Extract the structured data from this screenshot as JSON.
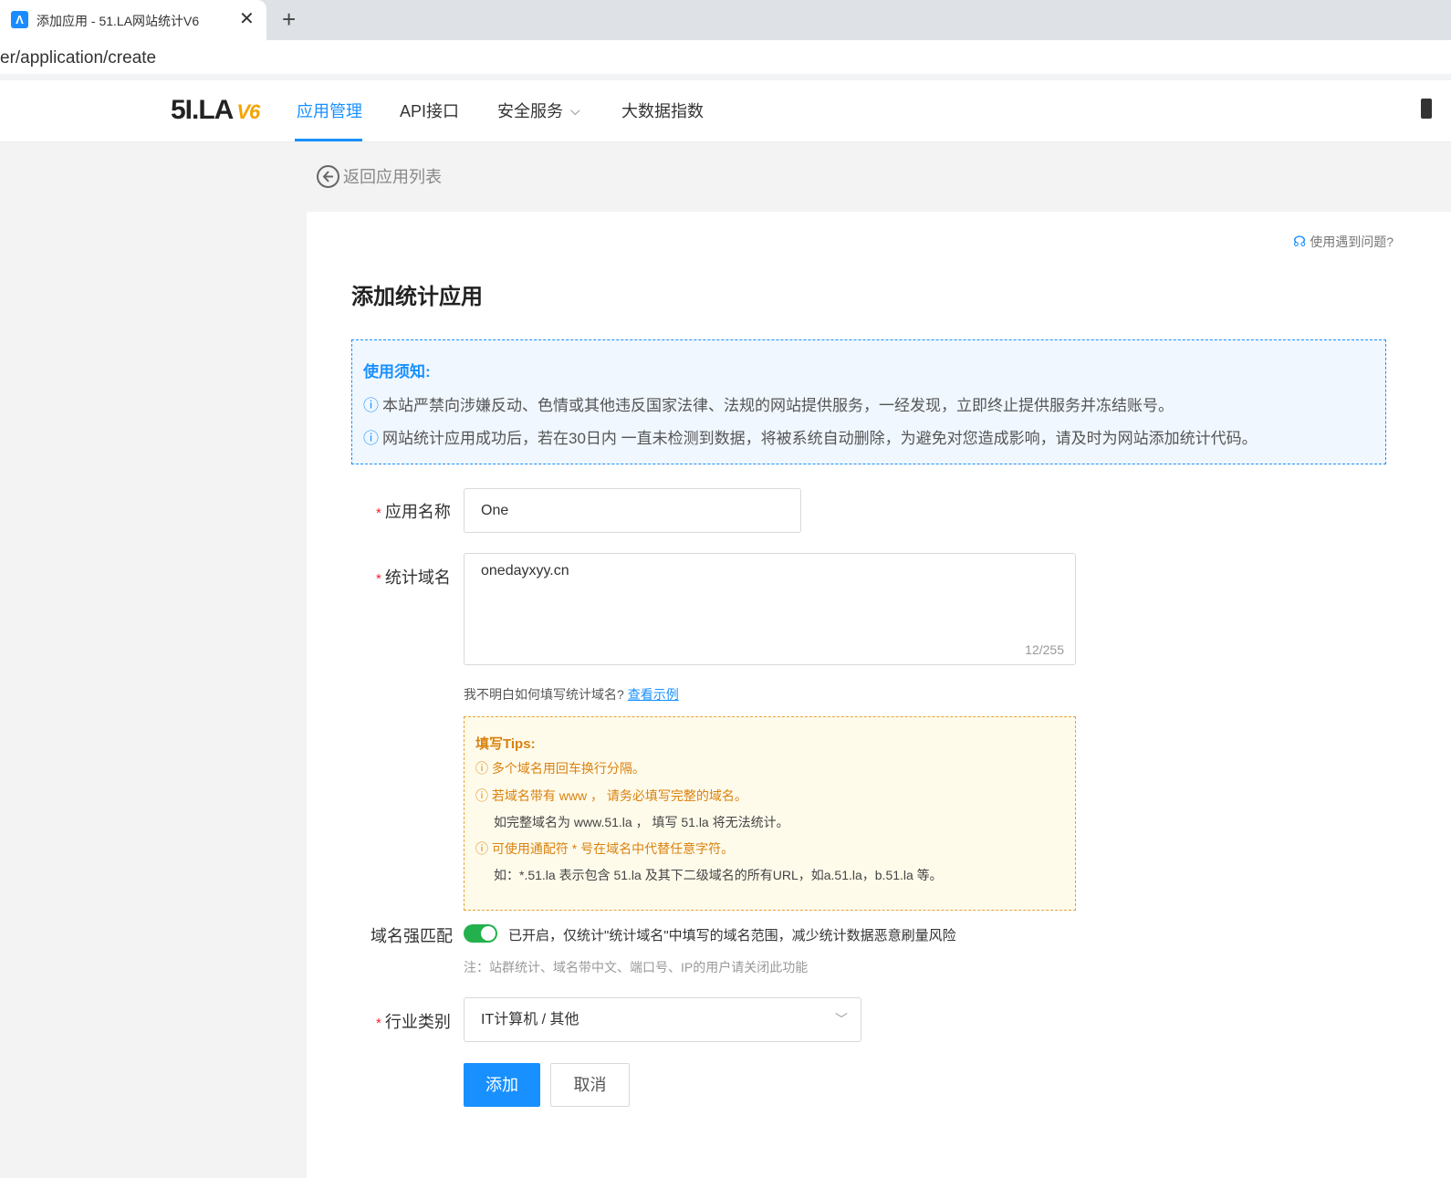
{
  "browser": {
    "tab_title": "添加应用 - 51.LA网站统计V6",
    "tab_close": "✕",
    "new_tab": "+",
    "address": "er/application/create"
  },
  "header": {
    "logo_main": "5I.LA",
    "logo_version": "V6",
    "nav": [
      {
        "label": "应用管理",
        "active": true
      },
      {
        "label": "API接口",
        "active": false
      },
      {
        "label": "安全服务",
        "active": false
      },
      {
        "label": "大数据指数",
        "active": false
      }
    ]
  },
  "back": {
    "label": "返回应用列表"
  },
  "help": {
    "label": "使用遇到问题?"
  },
  "page": {
    "title": "添加统计应用"
  },
  "notice": {
    "title": "使用须知:",
    "lines": [
      "本站严禁向涉嫌反动、色情或其他违反国家法律、法规的网站提供服务，一经发现，立即终止提供服务并冻结账号。",
      "网站统计应用成功后，若在30日内 一直未检测到数据，将被系统自动删除，为避免对您造成影响，请及时为网站添加统计代码。"
    ]
  },
  "form": {
    "required_mark": "*",
    "app_name": {
      "label": "应用名称",
      "value": "One"
    },
    "domain": {
      "label": "统计域名",
      "value": "onedayxyy.cn",
      "counter": "12/255"
    },
    "hint": {
      "text": "我不明白如何填写统计域名?",
      "link": "查看示例"
    },
    "tips": {
      "title": "填写Tips:",
      "items": [
        "多个域名用回车换行分隔。",
        "若域名带有 www ， 请务必填写完整的域名。",
        "如完整域名为 www.51.la ， 填写 51.la 将无法统计。",
        "可使用通配符 * 号在域名中代替任意字符。",
        "如：*.51.la 表示包含 51.la 及其下二级域名的所有URL，如a.51.la，b.51.la 等。"
      ]
    },
    "strict_match": {
      "label": "域名强匹配",
      "on": true,
      "description": "已开启，仅统计\"统计域名\"中填写的域名范围，减少统计数据恶意刷量风险",
      "note": "注：站群统计、域名带中文、端口号、IP的用户请关闭此功能"
    },
    "industry": {
      "label": "行业类别",
      "value": "IT计算机 / 其他"
    },
    "submit": "添加",
    "cancel": "取消"
  },
  "colors": {
    "primary": "#1890ff",
    "switch_on": "#22b14c",
    "tips": "#d9820f",
    "required": "#f5222d"
  },
  "icons": [
    "back-circle-arrow-icon",
    "headset-icon",
    "info-circle-icon",
    "chevron-down-icon"
  ]
}
